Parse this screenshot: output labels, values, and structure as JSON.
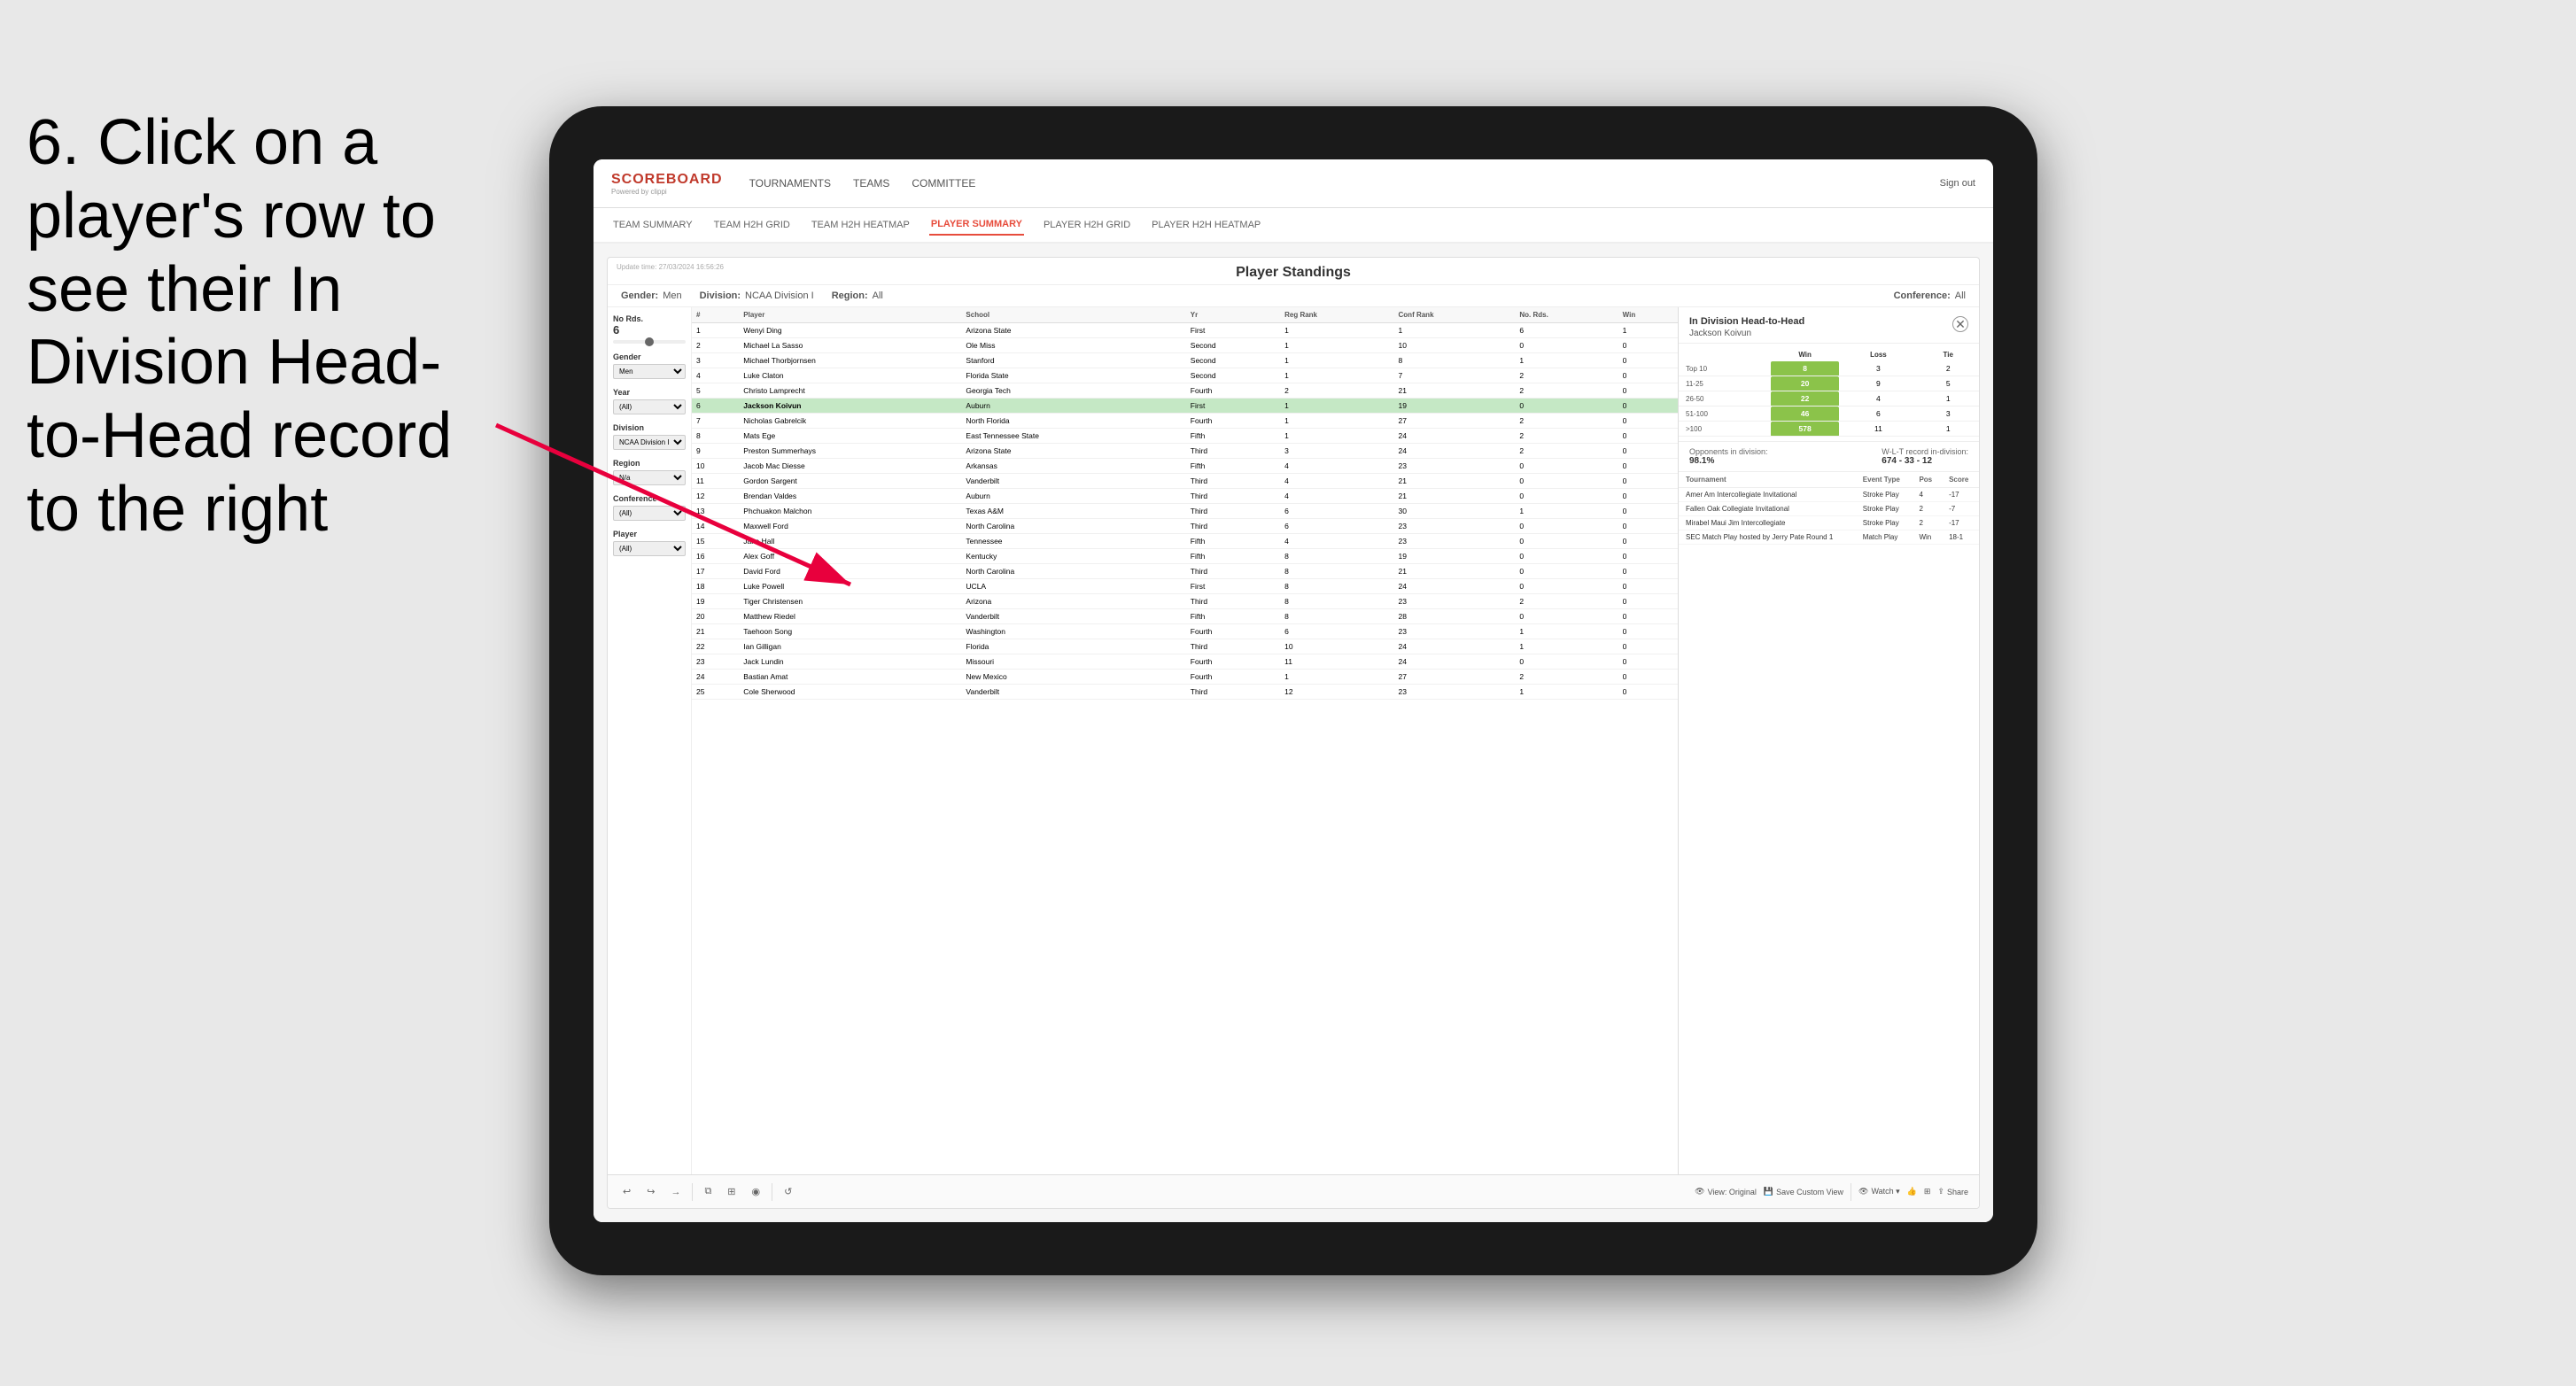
{
  "instruction": {
    "step": "6.",
    "text": "Click on a player's row to see their In Division Head-to-Head record to the right"
  },
  "nav": {
    "logo_main": "SCOREBOARD",
    "logo_sub": "Powered by clippi",
    "links": [
      "TOURNAMENTS",
      "TEAMS",
      "COMMITTEE"
    ],
    "sign_out": "Sign out"
  },
  "sub_nav": {
    "links": [
      "TEAM SUMMARY",
      "TEAM H2H GRID",
      "TEAM H2H HEATMAP",
      "PLAYER SUMMARY",
      "PLAYER H2H GRID",
      "PLAYER H2H HEATMAP"
    ],
    "active": "PLAYER SUMMARY"
  },
  "standings": {
    "title": "Player Standings",
    "update_time": "Update time:\n27/03/2024 16:56:26",
    "filters": {
      "gender_label": "Gender:",
      "gender_value": "Men",
      "division_label": "Division:",
      "division_value": "NCAA Division I",
      "region_label": "Region:",
      "region_value": "All",
      "conference_label": "Conference:",
      "conference_value": "All"
    }
  },
  "left_filters": {
    "no_rds_label": "No Rds.",
    "no_rds_value": "6",
    "gender_label": "Gender",
    "gender_value": "Men",
    "year_label": "Year",
    "year_value": "(All)",
    "division_label": "Division",
    "division_value": "NCAA Division I",
    "region_label": "Region",
    "region_value": "N/a",
    "conference_label": "Conference",
    "conference_value": "(All)",
    "player_label": "Player",
    "player_value": "(All)"
  },
  "table": {
    "columns": [
      "#",
      "Player",
      "School",
      "Yr",
      "Reg Rank",
      "Conf Rank",
      "No. Rds.",
      "Win"
    ],
    "rows": [
      {
        "num": "1",
        "player": "Wenyi Ding",
        "school": "Arizona State",
        "yr": "First",
        "reg": "1",
        "conf": "1",
        "rds": "6",
        "win": "1",
        "selected": false
      },
      {
        "num": "2",
        "player": "Michael La Sasso",
        "school": "Ole Miss",
        "yr": "Second",
        "reg": "1",
        "conf": "10",
        "rds": "0",
        "win": "0",
        "selected": false
      },
      {
        "num": "3",
        "player": "Michael Thorbjornsen",
        "school": "Stanford",
        "yr": "Second",
        "reg": "1",
        "conf": "8",
        "rds": "1",
        "win": "0",
        "selected": false
      },
      {
        "num": "4",
        "player": "Luke Claton",
        "school": "Florida State",
        "yr": "Second",
        "reg": "1",
        "conf": "7",
        "rds": "2",
        "win": "0",
        "selected": false
      },
      {
        "num": "5",
        "player": "Christo Lamprecht",
        "school": "Georgia Tech",
        "yr": "Fourth",
        "reg": "2",
        "conf": "21",
        "rds": "2",
        "win": "0",
        "selected": false
      },
      {
        "num": "6",
        "player": "Jackson Koivun",
        "school": "Auburn",
        "yr": "First",
        "reg": "1",
        "conf": "19",
        "rds": "0",
        "win": "0",
        "selected": true
      },
      {
        "num": "7",
        "player": "Nicholas Gabrelcik",
        "school": "North Florida",
        "yr": "Fourth",
        "reg": "1",
        "conf": "27",
        "rds": "2",
        "win": "0",
        "selected": false
      },
      {
        "num": "8",
        "player": "Mats Ege",
        "school": "East Tennessee State",
        "yr": "Fifth",
        "reg": "1",
        "conf": "24",
        "rds": "2",
        "win": "0",
        "selected": false
      },
      {
        "num": "9",
        "player": "Preston Summerhays",
        "school": "Arizona State",
        "yr": "Third",
        "reg": "3",
        "conf": "24",
        "rds": "2",
        "win": "0",
        "selected": false
      },
      {
        "num": "10",
        "player": "Jacob Mac Diesse",
        "school": "Arkansas",
        "yr": "Fifth",
        "reg": "4",
        "conf": "23",
        "rds": "0",
        "win": "0",
        "selected": false
      },
      {
        "num": "11",
        "player": "Gordon Sargent",
        "school": "Vanderbilt",
        "yr": "Third",
        "reg": "4",
        "conf": "21",
        "rds": "0",
        "win": "0",
        "selected": false
      },
      {
        "num": "12",
        "player": "Brendan Valdes",
        "school": "Auburn",
        "yr": "Third",
        "reg": "4",
        "conf": "21",
        "rds": "0",
        "win": "0",
        "selected": false
      },
      {
        "num": "13",
        "player": "Phchuakon Malchon",
        "school": "Texas A&M",
        "yr": "Third",
        "reg": "6",
        "conf": "30",
        "rds": "1",
        "win": "0",
        "selected": false
      },
      {
        "num": "14",
        "player": "Maxwell Ford",
        "school": "North Carolina",
        "yr": "Third",
        "reg": "6",
        "conf": "23",
        "rds": "0",
        "win": "0",
        "selected": false
      },
      {
        "num": "15",
        "player": "Jake Hall",
        "school": "Tennessee",
        "yr": "Fifth",
        "reg": "4",
        "conf": "23",
        "rds": "0",
        "win": "0",
        "selected": false
      },
      {
        "num": "16",
        "player": "Alex Goff",
        "school": "Kentucky",
        "yr": "Fifth",
        "reg": "8",
        "conf": "19",
        "rds": "0",
        "win": "0",
        "selected": false
      },
      {
        "num": "17",
        "player": "David Ford",
        "school": "North Carolina",
        "yr": "Third",
        "reg": "8",
        "conf": "21",
        "rds": "0",
        "win": "0",
        "selected": false
      },
      {
        "num": "18",
        "player": "Luke Powell",
        "school": "UCLA",
        "yr": "First",
        "reg": "8",
        "conf": "24",
        "rds": "0",
        "win": "0",
        "selected": false
      },
      {
        "num": "19",
        "player": "Tiger Christensen",
        "school": "Arizona",
        "yr": "Third",
        "reg": "8",
        "conf": "23",
        "rds": "2",
        "win": "0",
        "selected": false
      },
      {
        "num": "20",
        "player": "Matthew Riedel",
        "school": "Vanderbilt",
        "yr": "Fifth",
        "reg": "8",
        "conf": "28",
        "rds": "0",
        "win": "0",
        "selected": false
      },
      {
        "num": "21",
        "player": "Taehoon Song",
        "school": "Washington",
        "yr": "Fourth",
        "reg": "6",
        "conf": "23",
        "rds": "1",
        "win": "0",
        "selected": false
      },
      {
        "num": "22",
        "player": "Ian Gilligan",
        "school": "Florida",
        "yr": "Third",
        "reg": "10",
        "conf": "24",
        "rds": "1",
        "win": "0",
        "selected": false
      },
      {
        "num": "23",
        "player": "Jack Lundin",
        "school": "Missouri",
        "yr": "Fourth",
        "reg": "11",
        "conf": "24",
        "rds": "0",
        "win": "0",
        "selected": false
      },
      {
        "num": "24",
        "player": "Bastian Amat",
        "school": "New Mexico",
        "yr": "Fourth",
        "reg": "1",
        "conf": "27",
        "rds": "2",
        "win": "0",
        "selected": false
      },
      {
        "num": "25",
        "player": "Cole Sherwood",
        "school": "Vanderbilt",
        "yr": "Third",
        "reg": "12",
        "conf": "23",
        "rds": "1",
        "win": "0",
        "selected": false
      }
    ]
  },
  "h2h": {
    "title": "In Division Head-to-Head",
    "player_name": "Jackson Koivun",
    "table_headers": [
      "",
      "Win",
      "Loss",
      "Tie"
    ],
    "rows": [
      {
        "rank": "Top 10",
        "win": "8",
        "loss": "3",
        "tie": "2"
      },
      {
        "rank": "11-25",
        "win": "20",
        "loss": "9",
        "tie": "5"
      },
      {
        "rank": "26-50",
        "win": "22",
        "loss": "4",
        "tie": "1"
      },
      {
        "rank": "51-100",
        "win": "46",
        "loss": "6",
        "tie": "3"
      },
      {
        "rank": ">100",
        "win": "578",
        "loss": "11",
        "tie": "1"
      }
    ],
    "opponents_label": "Opponents in division:",
    "opponents_value": "98.1%",
    "record_label": "W-L-T record in-division:",
    "record_value": "674 - 33 - 12",
    "tournaments_headers": [
      "Tournament",
      "Event Type",
      "Pos",
      "Score"
    ],
    "tournaments": [
      {
        "name": "Amer Am Intercollegiate Invitational",
        "type": "Stroke Play",
        "pos": "4",
        "score": "-17"
      },
      {
        "name": "Fallen Oak Collegiate Invitational",
        "type": "Stroke Play",
        "pos": "2",
        "score": "-7"
      },
      {
        "name": "Mirabel Maui Jim Intercollegiate",
        "type": "Stroke Play",
        "pos": "2",
        "score": "-17"
      },
      {
        "name": "SEC Match Play hosted by Jerry Pate Round 1",
        "type": "Match Play",
        "pos": "Win",
        "score": "18-1"
      }
    ]
  },
  "toolbar": {
    "undo": "↩",
    "redo": "↪",
    "forward": "→",
    "copy": "⧉",
    "paste": "📋",
    "camera": "📷",
    "refresh": "↺",
    "view_original": "View: Original",
    "save_custom": "Save Custom View",
    "watch": "Watch ▾",
    "share_icon": "⇪",
    "grid_icon": "⊞",
    "share": "Share"
  }
}
